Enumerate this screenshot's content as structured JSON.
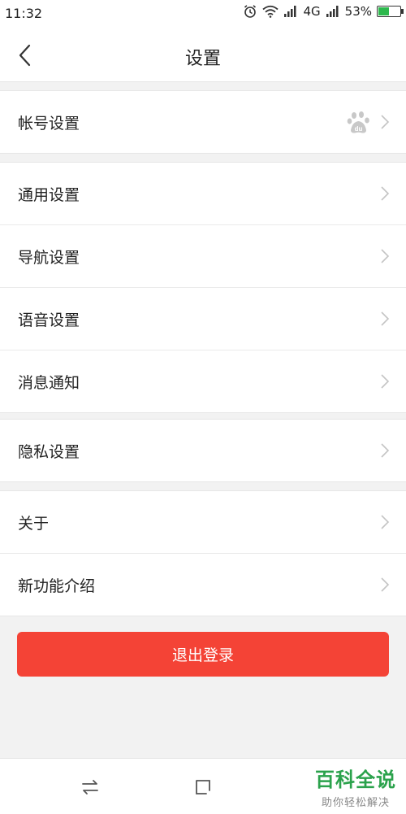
{
  "status_bar": {
    "time": "11:32",
    "network": "4G",
    "battery_text": "53%",
    "battery_level": 0.53
  },
  "header": {
    "title": "设置"
  },
  "groups": [
    {
      "items": [
        {
          "label": "帐号设置",
          "has_baidu_icon": true
        }
      ]
    },
    {
      "items": [
        {
          "label": "通用设置"
        },
        {
          "label": "导航设置"
        },
        {
          "label": "语音设置"
        },
        {
          "label": "消息通知"
        }
      ]
    },
    {
      "items": [
        {
          "label": "隐私设置"
        }
      ]
    },
    {
      "items": [
        {
          "label": "关于"
        },
        {
          "label": "新功能介绍"
        }
      ]
    }
  ],
  "logout_label": "退出登录",
  "watermark": {
    "title": "百科全说",
    "subtitle": "助你轻松解决"
  },
  "colors": {
    "accent_red": "#f44336",
    "watermark_green": "#2ba24c",
    "battery_green": "#2db84d"
  },
  "icons": [
    "back-arrow-icon",
    "alarm-icon",
    "wifi-icon",
    "signal-icon",
    "battery-icon",
    "baidu-paw-icon",
    "chevron-right-icon",
    "switch-arrows-icon",
    "square-nav-icon"
  ]
}
